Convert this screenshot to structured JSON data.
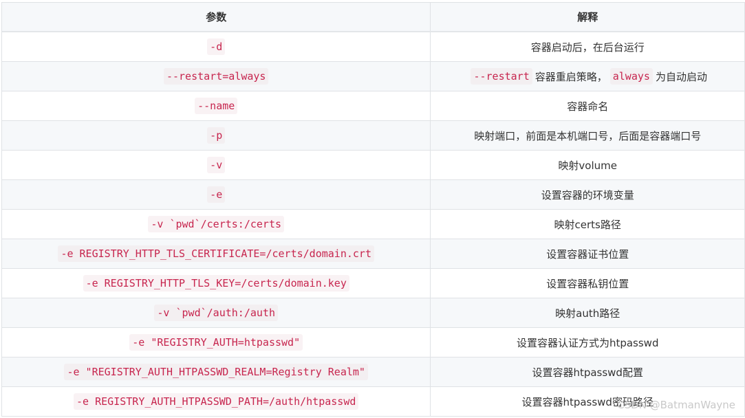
{
  "table": {
    "headers": [
      "参数",
      "解释"
    ],
    "rows": [
      {
        "param": "-d",
        "desc": "容器启动后，在后台运行"
      },
      {
        "param": "--restart=always",
        "desc_parts": [
          {
            "type": "code",
            "text": "--restart"
          },
          {
            "type": "text",
            "text": "容器重启策略，"
          },
          {
            "type": "code",
            "text": "always"
          },
          {
            "type": "text",
            "text": "为自动启动"
          }
        ]
      },
      {
        "param": "--name",
        "desc": "容器命名"
      },
      {
        "param": "-p",
        "desc": "映射端口，前面是本机端口号，后面是容器端口号"
      },
      {
        "param": "-v",
        "desc": "映射volume"
      },
      {
        "param": "-e",
        "desc": "设置容器的环境变量"
      },
      {
        "param": "-v `pwd`/certs:/certs",
        "desc": "映射certs路径"
      },
      {
        "param": "-e REGISTRY_HTTP_TLS_CERTIFICATE=/certs/domain.crt",
        "desc": "设置容器证书位置"
      },
      {
        "param": "-e REGISTRY_HTTP_TLS_KEY=/certs/domain.key",
        "desc": "设置容器私钥位置"
      },
      {
        "param": "-v `pwd`/auth:/auth",
        "desc": "映射auth路径"
      },
      {
        "param": "-e \"REGISTRY_AUTH=htpasswd\"",
        "desc": "设置容器认证方式为htpasswd"
      },
      {
        "param": "-e \"REGISTRY_AUTH_HTPASSWD_REALM=Registry Realm\"",
        "desc": "设置容器htpasswd配置"
      },
      {
        "param": "-e REGISTRY_AUTH_HTPASSWD_PATH=/auth/htpasswd",
        "desc": "设置容器htpasswd密码路径"
      }
    ]
  },
  "watermark": "CSDN @BatmanWayne",
  "colors": {
    "code_text": "#c7254e",
    "code_bg": "#f9f2f4",
    "header_bg": "#f6f8fa",
    "border": "#dfe2e5"
  }
}
